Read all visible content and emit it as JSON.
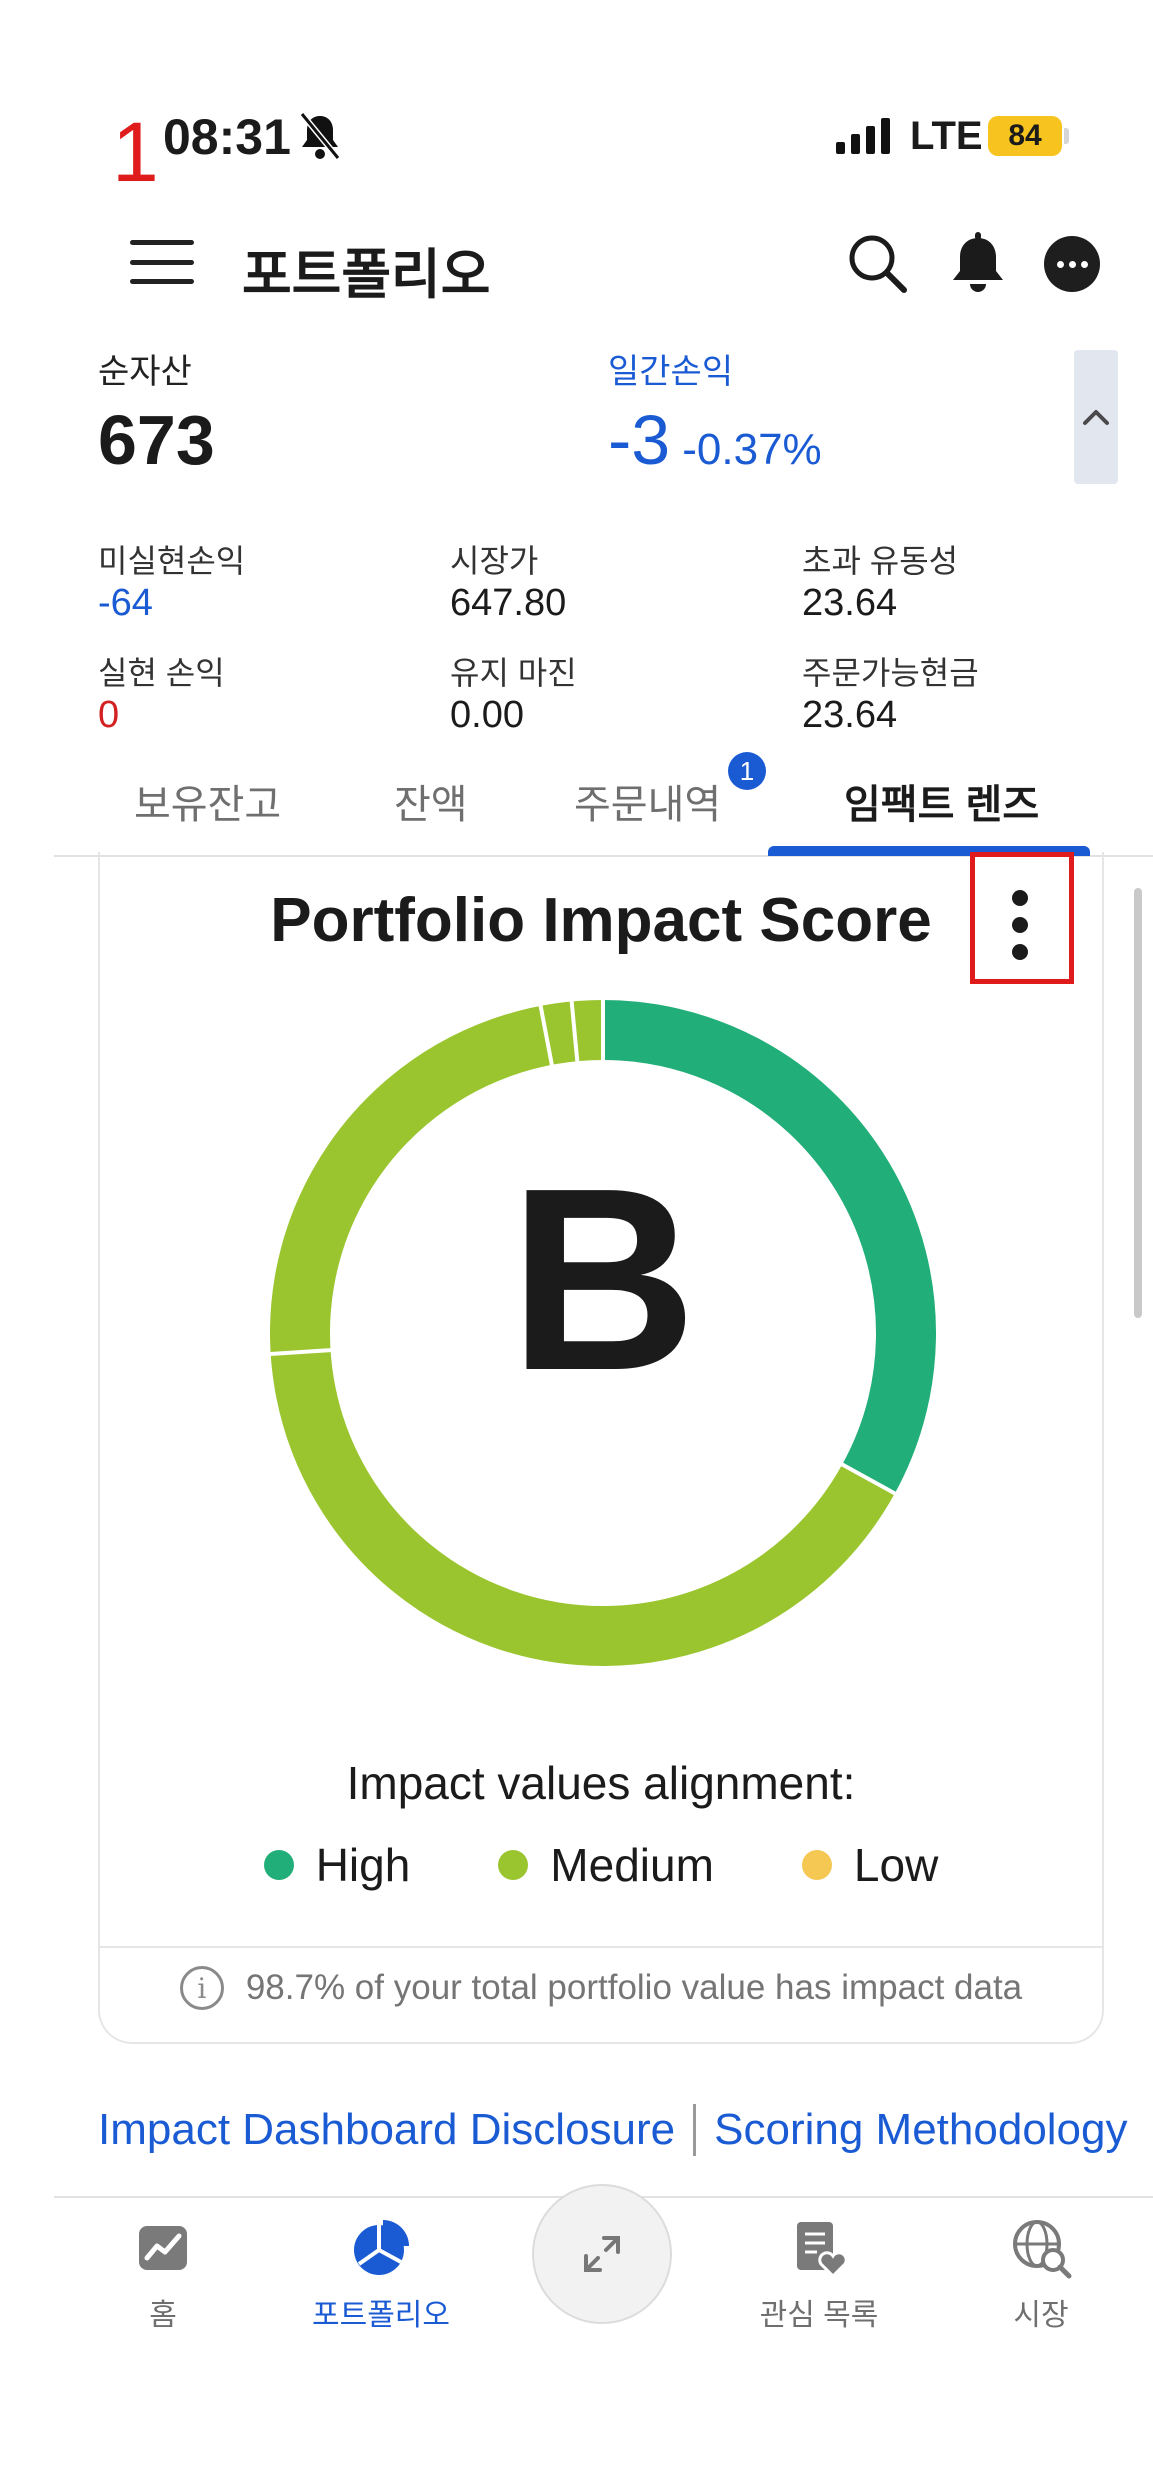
{
  "annotation": {
    "step_number": "1"
  },
  "status_bar": {
    "time": "08:31",
    "network": "LTE",
    "battery": "84"
  },
  "header": {
    "title": "포트폴리오"
  },
  "summary": {
    "net_assets_label": "순자산",
    "net_assets_value": "673",
    "daily_pl_label": "일간손익",
    "daily_pl_value": "-3",
    "daily_pl_percent": "-0.37%",
    "metrics": [
      {
        "label": "미실현손익",
        "value": "-64",
        "tone": "blue"
      },
      {
        "label": "시장가",
        "value": "647.80",
        "tone": "normal"
      },
      {
        "label": "초과 유동성",
        "value": "23.64",
        "tone": "normal"
      },
      {
        "label": "실현 손익",
        "value": "0",
        "tone": "red"
      },
      {
        "label": "유지 마진",
        "value": "0.00",
        "tone": "normal"
      },
      {
        "label": "주문가능현금",
        "value": "23.64",
        "tone": "normal"
      }
    ]
  },
  "tabs": [
    {
      "label": "보유잔고",
      "active": false
    },
    {
      "label": "잔액",
      "active": false
    },
    {
      "label": "주문내역",
      "active": false,
      "badge": "1"
    },
    {
      "label": "임팩트 렌즈",
      "active": true
    }
  ],
  "impact_card": {
    "title": "Portfolio Impact Score",
    "grade": "B",
    "alignment_label": "Impact values alignment:",
    "legend": [
      {
        "label": "High",
        "color": "#22ae78"
      },
      {
        "label": "Medium",
        "color": "#9ac52e"
      },
      {
        "label": "Low",
        "color": "#f5c853"
      }
    ],
    "footer_note": "98.7% of your total portfolio value has impact data"
  },
  "chart_data": {
    "type": "pie",
    "categories": [
      "High",
      "Medium",
      "Low"
    ],
    "values": [
      33,
      67,
      0
    ],
    "colors": [
      "#22ae78",
      "#9ac52e",
      "#f5c853"
    ],
    "center_label": "B"
  },
  "links": {
    "disclosure": "Impact Dashboard Disclosure",
    "methodology": "Scoring Methodology"
  },
  "bottom_nav": [
    {
      "label": "홈",
      "icon": "home-chart-icon",
      "active": false
    },
    {
      "label": "포트폴리오",
      "icon": "portfolio-pie-icon",
      "active": true
    },
    {
      "label": "관심 목록",
      "icon": "watchlist-icon",
      "active": false
    },
    {
      "label": "시장",
      "icon": "market-globe-icon",
      "active": false
    }
  ],
  "colors": {
    "accent": "#1a5bd4",
    "negative": "#d32020",
    "highlight_box": "#e01b1b"
  }
}
